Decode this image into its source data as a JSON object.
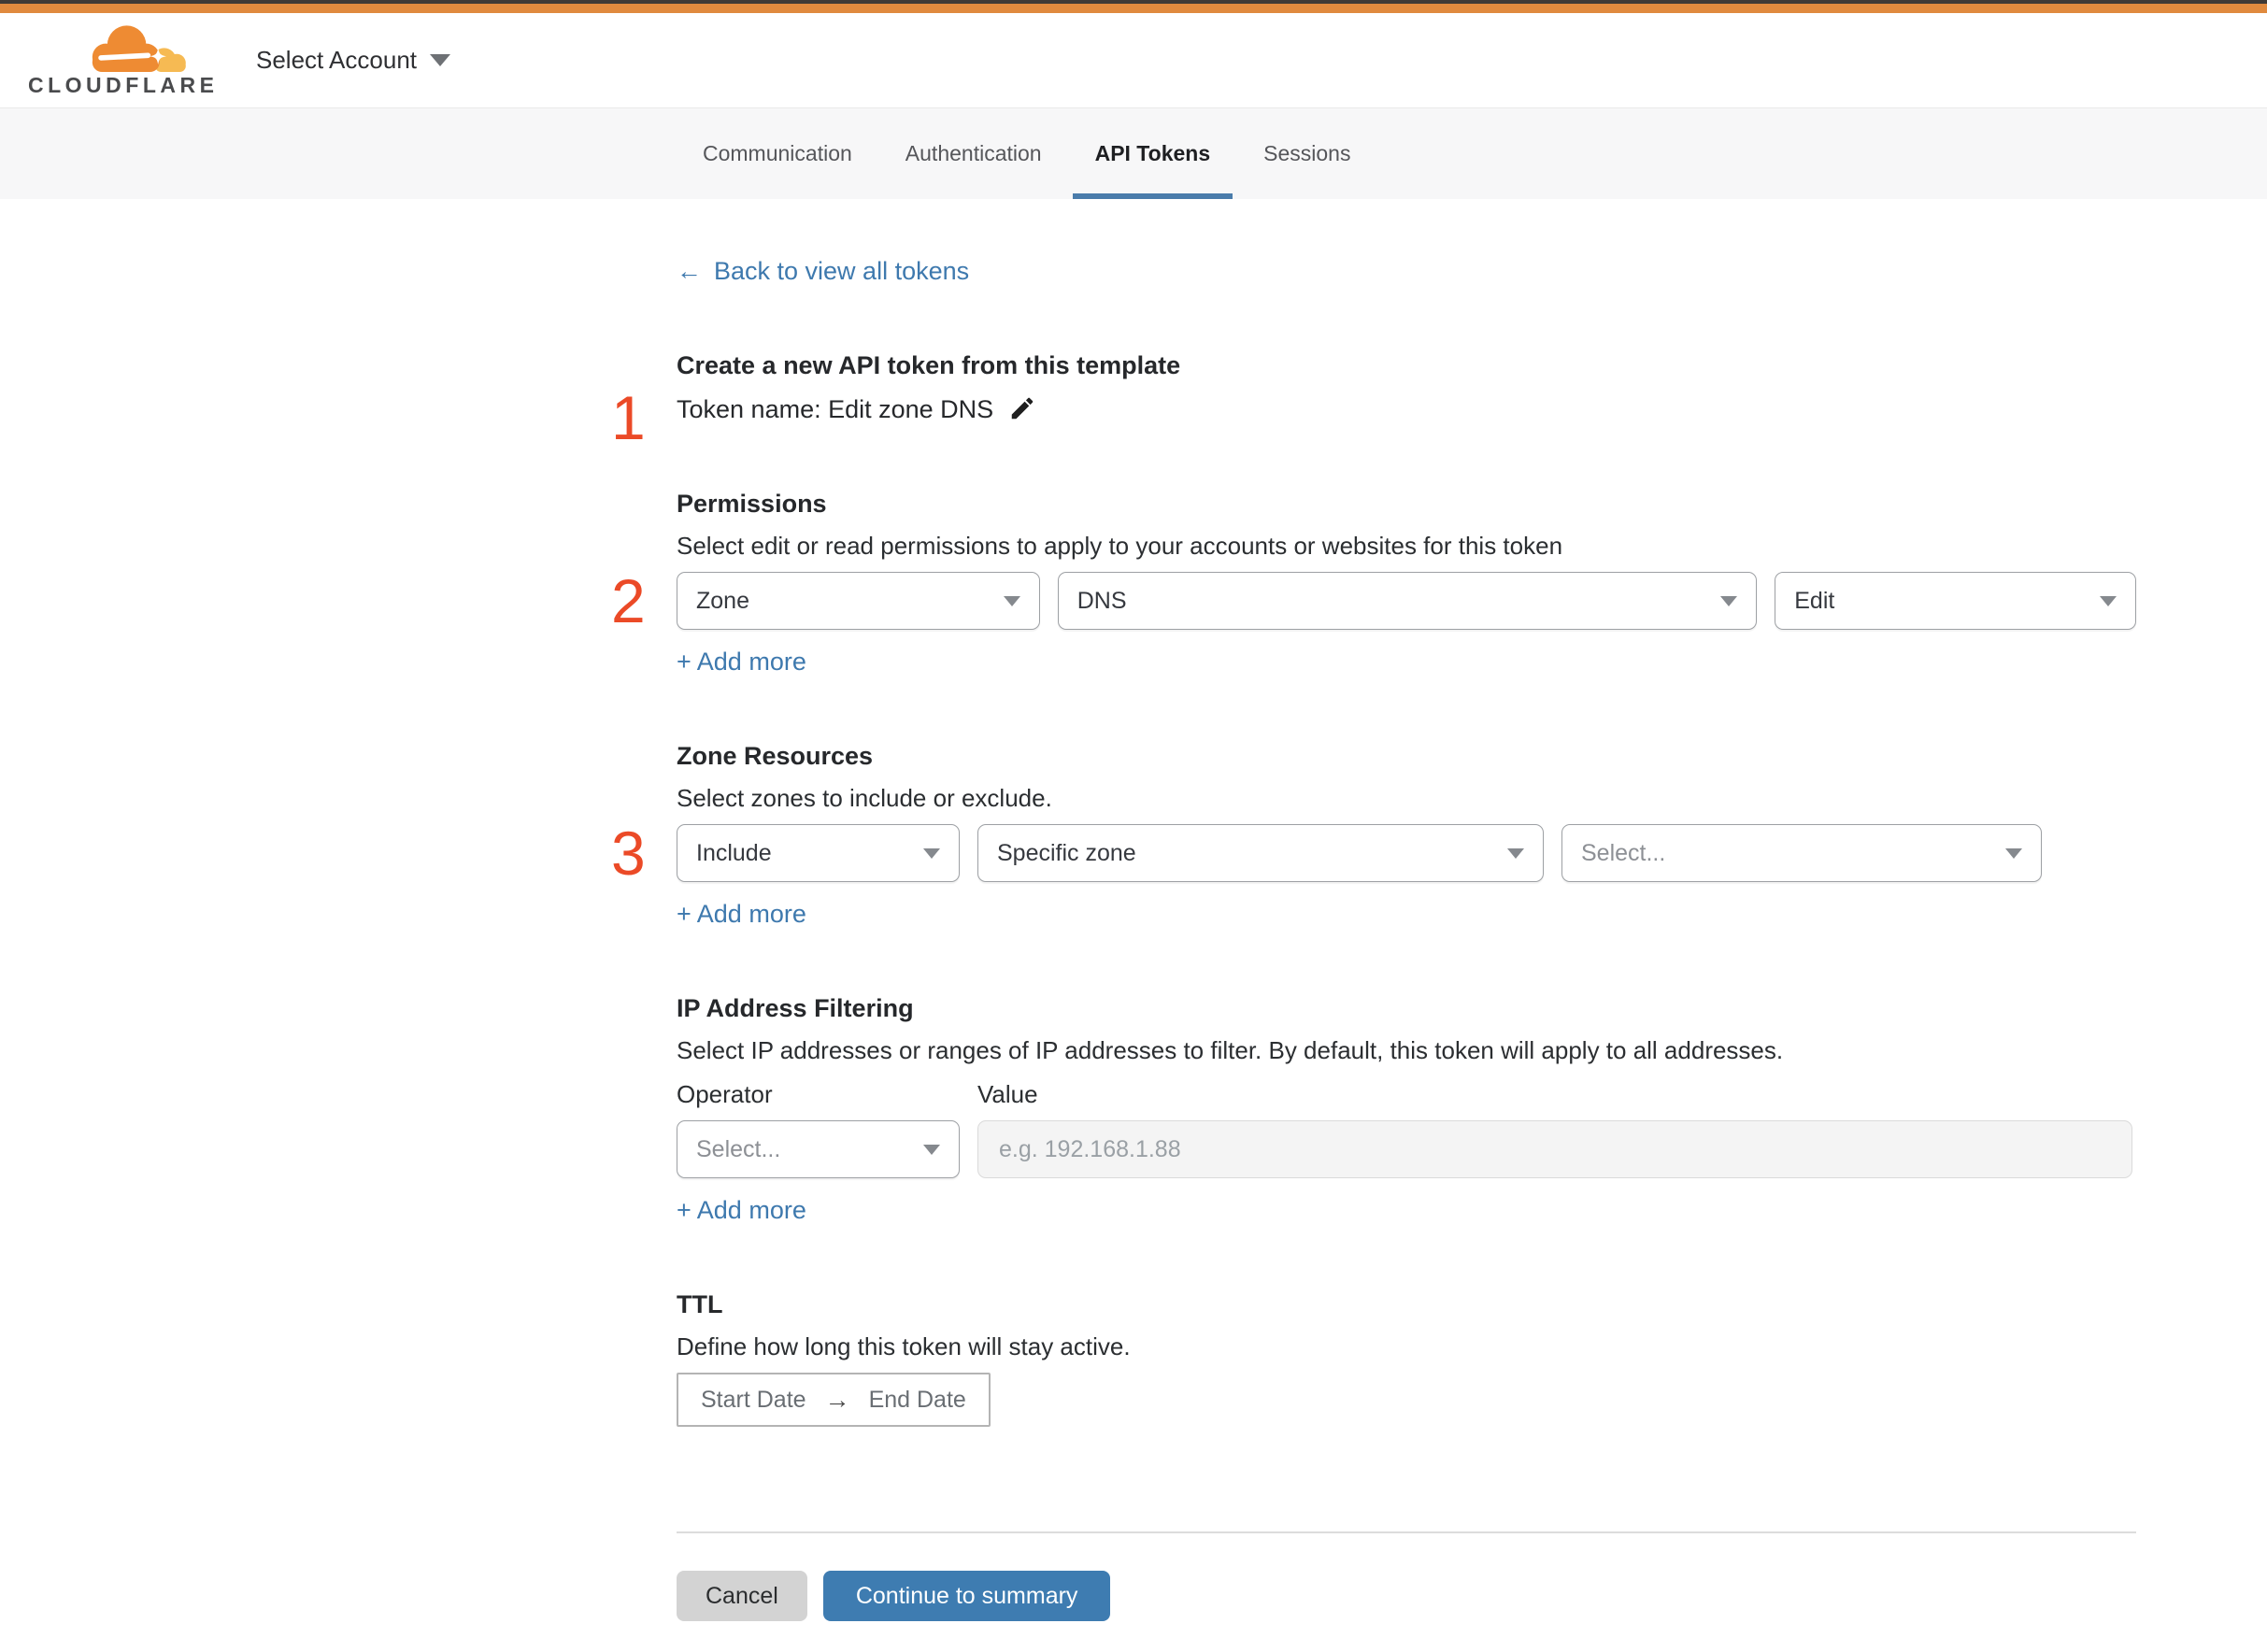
{
  "header": {
    "logo_text": "CLOUDFLARE",
    "account_selector_label": "Select Account"
  },
  "tabs": [
    {
      "label": "Communication"
    },
    {
      "label": "Authentication"
    },
    {
      "label": "API Tokens"
    },
    {
      "label": "Sessions"
    }
  ],
  "page": {
    "back_arrow": "←",
    "back_link_label": "Back to view all tokens"
  },
  "sections": {
    "create": {
      "step_number": "1",
      "heading": "Create a new API token from this template",
      "token_name_line": "Token name: Edit zone DNS"
    },
    "permissions": {
      "step_number": "2",
      "heading": "Permissions",
      "description": "Select edit or read permissions to apply to your accounts or websites for this token",
      "scope_select_value": "Zone",
      "service_select_value": "DNS",
      "access_select_value": "Edit",
      "add_more_label": "+ Add more"
    },
    "zone_resources": {
      "step_number": "3",
      "heading": "Zone Resources",
      "description": "Select zones to include or exclude.",
      "mode_select_value": "Include",
      "scope_select_value": "Specific zone",
      "zone_select_placeholder": "Select...",
      "add_more_label": "+ Add more"
    },
    "ip_filtering": {
      "heading": "IP Address Filtering",
      "description": "Select IP addresses or ranges of IP addresses to filter. By default, this token will apply to all addresses.",
      "operator_label": "Operator",
      "value_label": "Value",
      "operator_select_placeholder": "Select...",
      "value_placeholder": "e.g. 192.168.1.88",
      "add_more_label": "+ Add more"
    },
    "ttl": {
      "heading": "TTL",
      "description": "Define how long this token will stay active.",
      "start_date_label": "Start Date",
      "range_arrow": "→",
      "end_date_label": "End Date"
    }
  },
  "footer": {
    "cancel_label": "Cancel",
    "continue_label": "Continue to summary"
  },
  "colors": {
    "top_bar_orange": "#e08a3e",
    "logo_cloud_orange": "#ee8b33",
    "logo_cloud_light": "#f6ba53",
    "step_number_red": "#eb4a27",
    "link_blue": "#3e79ae",
    "active_tab_blue": "#4a7cab",
    "primary_button_blue": "#3e7cb1"
  }
}
